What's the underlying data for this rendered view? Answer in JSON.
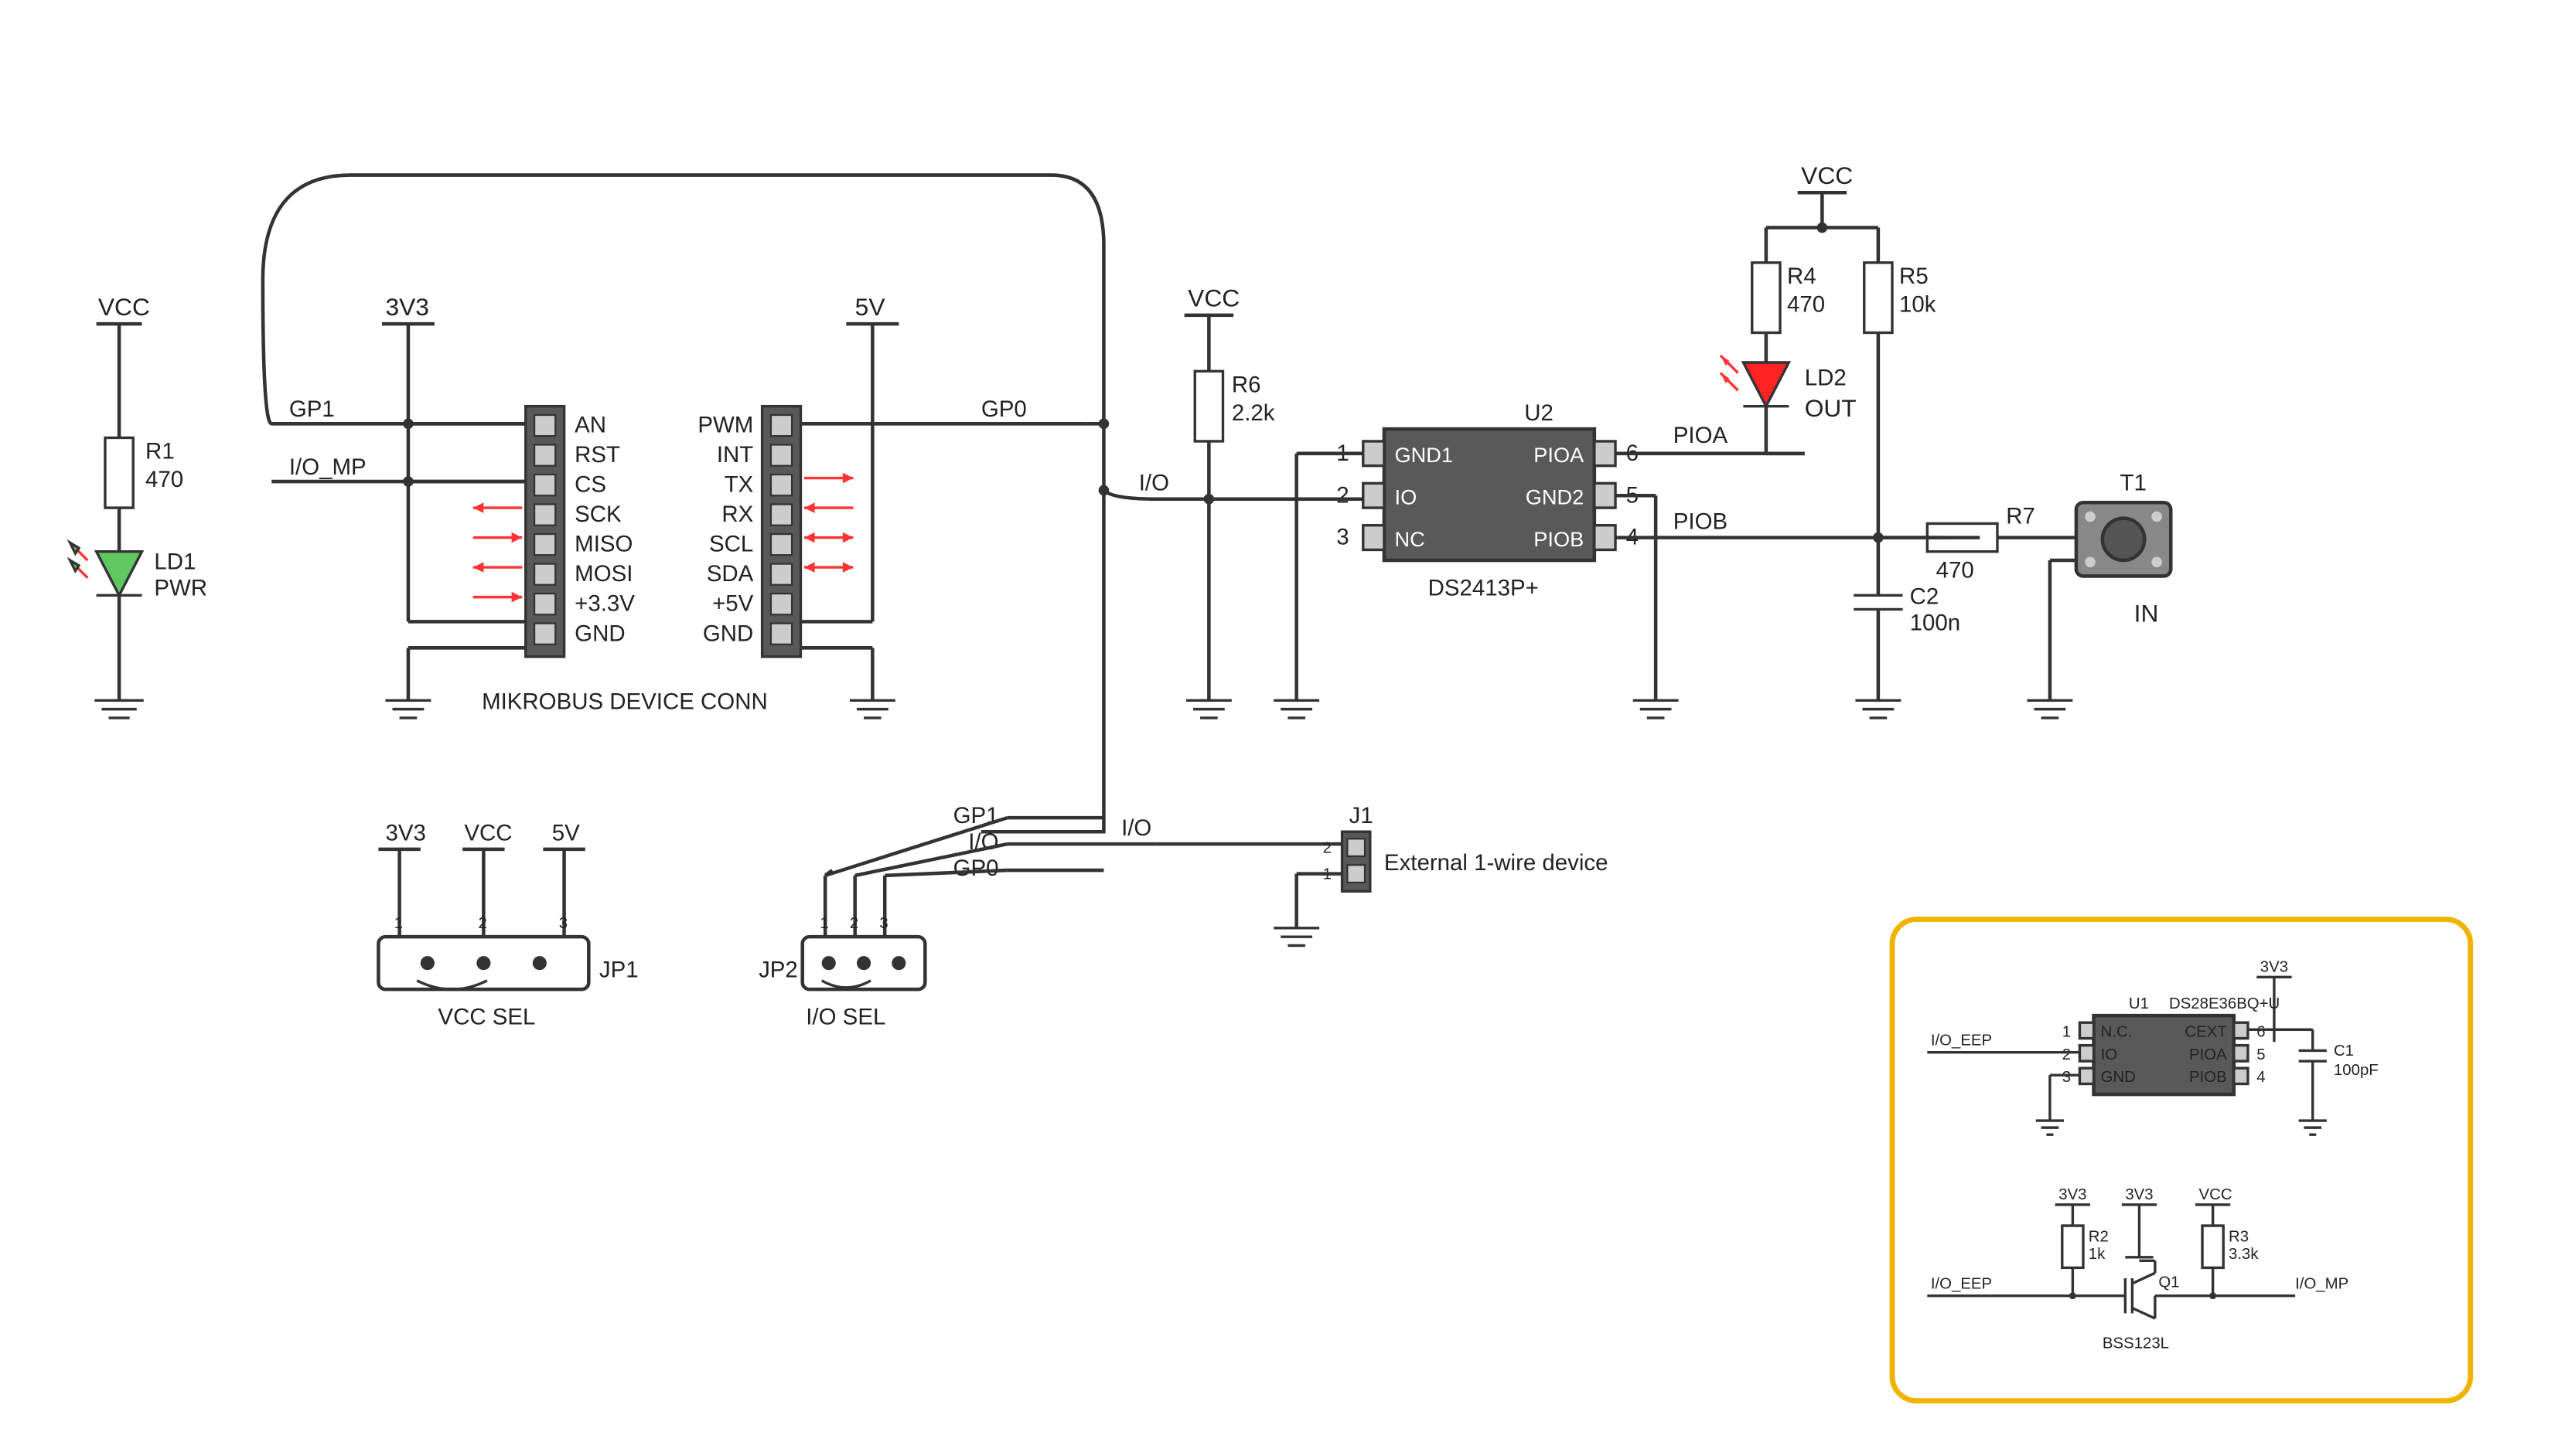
{
  "power": {
    "vcc_left": "VCC",
    "v33": "3V3",
    "v5": "5V",
    "vcc_mid": "VCC",
    "vcc_right": "VCC"
  },
  "r1": {
    "ref": "R1",
    "val": "470"
  },
  "r4": {
    "ref": "R4",
    "val": "470"
  },
  "r5": {
    "ref": "R5",
    "val": "10k"
  },
  "r6": {
    "ref": "R6",
    "val": "2.2k"
  },
  "r7": {
    "ref": "R7",
    "val": "470"
  },
  "c2": {
    "ref": "C2",
    "val": "100n"
  },
  "ld1": {
    "ref": "LD1",
    "name": "PWR"
  },
  "ld2": {
    "ref": "LD2",
    "name": "OUT"
  },
  "t1": {
    "ref": "T1",
    "name": "IN"
  },
  "nets": {
    "gp1": "GP1",
    "gp0": "GP0",
    "io_mp": "I/O_MP",
    "io": "I/O",
    "pioa": "PIOA",
    "piob": "PIOB",
    "io2": "I/O"
  },
  "u2": {
    "ref": "U2",
    "part": "DS2413P+",
    "pins": {
      "p1": "1",
      "p2": "2",
      "p3": "3",
      "p4": "4",
      "p5": "5",
      "p6": "6",
      "gnd1": "GND1",
      "io": "IO",
      "nc": "NC",
      "piob": "PIOB",
      "gnd2": "GND2",
      "pioa": "PIOA"
    }
  },
  "mikrobus": {
    "title": "MIKROBUS DEVICE CONN",
    "left": [
      "AN",
      "RST",
      "CS",
      "SCK",
      "MISO",
      "MOSI",
      "+3.3V",
      "GND"
    ],
    "right": [
      "PWM",
      "INT",
      "TX",
      "RX",
      "SCL",
      "SDA",
      "+5V",
      "GND"
    ]
  },
  "jp1": {
    "ref": "JP1",
    "name": "VCC SEL",
    "p1": "1",
    "p2": "2",
    "p3": "3",
    "l1": "3V3",
    "l2": "VCC",
    "l3": "5V"
  },
  "jp2": {
    "ref": "JP2",
    "name": "I/O SEL",
    "p1": "1",
    "p2": "2",
    "p3": "3",
    "l1": "GP1",
    "l2": "I/O",
    "l3": "GP0"
  },
  "j1": {
    "ref": "J1",
    "name": "External 1-wire device",
    "p1": "1",
    "p2": "2"
  },
  "inset": {
    "u1": {
      "ref": "U1",
      "part": "DS28E36BQ+U",
      "pins": {
        "p1": "1",
        "p2": "2",
        "p3": "3",
        "p4": "4",
        "p5": "5",
        "p6": "6",
        "nc": "N.C.",
        "io": "IO",
        "gnd": "GND",
        "piob": "PIOB",
        "pioa": "PIOA",
        "cext": "CEXT"
      }
    },
    "c1": {
      "ref": "C1",
      "val": "100pF"
    },
    "v33": "3V3",
    "v33b": "3V3",
    "vcc": "VCC",
    "r2": {
      "ref": "R2",
      "val": "1k"
    },
    "r3": {
      "ref": "R3",
      "val": "3.3k"
    },
    "q1": {
      "ref": "Q1",
      "part": "BSS123L"
    },
    "net_eep": "I/O_EEP",
    "net_eep2": "I/O_EEP",
    "net_mp": "I/O_MP"
  }
}
